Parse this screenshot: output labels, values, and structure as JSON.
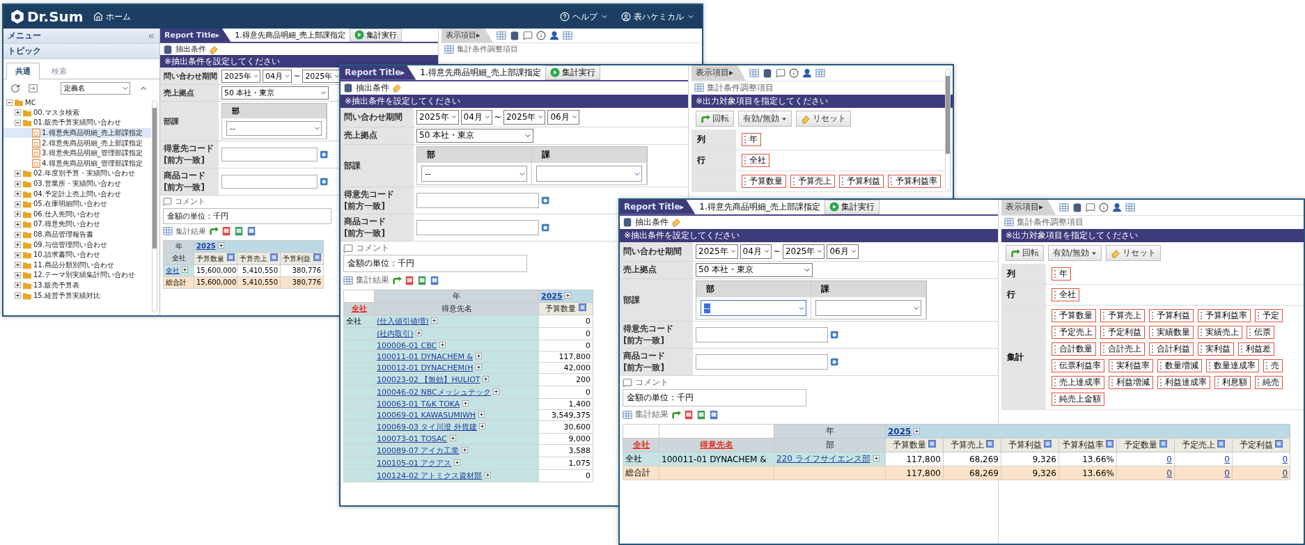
{
  "app": {
    "logo": "Dr.Sum",
    "home": "ホーム",
    "help": "ヘルプ",
    "user": "表ハケミカル"
  },
  "sidebar": {
    "menu": "メニュー",
    "topic": "トピック",
    "tabs": [
      {
        "label": "共通",
        "selected": true
      },
      {
        "label": "検索",
        "selected": false
      }
    ],
    "sort_select": "定義名",
    "tree": [
      {
        "label": "MC",
        "kind": "folder",
        "expanded": true,
        "selected": false,
        "children": [
          {
            "label": "00.マスタ検索",
            "kind": "folder",
            "expanded": false,
            "selected": false
          },
          {
            "label": "01.販売予算実績問い合わせ",
            "kind": "folder",
            "expanded": true,
            "selected": false,
            "children": [
              {
                "label": "1.得意先商品明細_売上部課指定",
                "kind": "report",
                "selected": true
              },
              {
                "label": "2.得意先商品明細_売上部課指定",
                "kind": "report",
                "selected": false
              },
              {
                "label": "3.得意先商品明細_管理部課指定",
                "kind": "report",
                "selected": false
              },
              {
                "label": "4.得意先商品明細_管理部課指定",
                "kind": "report",
                "selected": false
              }
            ]
          },
          {
            "label": "02.年度別予算・実績問い合わせ",
            "kind": "folder",
            "expanded": false,
            "selected": false
          },
          {
            "label": "03.営業所・実績問い合わせ",
            "kind": "folder",
            "expanded": false,
            "selected": false
          },
          {
            "label": "04.予定計上売上問い合わせ",
            "kind": "folder",
            "expanded": false,
            "selected": false
          },
          {
            "label": "05.在庫明細問い合わせ",
            "kind": "folder",
            "expanded": false,
            "selected": false
          },
          {
            "label": "06.仕入先問い合わせ",
            "kind": "folder",
            "expanded": false,
            "selected": false
          },
          {
            "label": "07.得意先問い合わせ",
            "kind": "folder",
            "expanded": false,
            "selected": false
          },
          {
            "label": "08.商品管理報告書",
            "kind": "folder",
            "expanded": false,
            "selected": false
          },
          {
            "label": "09.与信管理問い合わせ",
            "kind": "folder",
            "expanded": false,
            "selected": false
          },
          {
            "label": "10.請求書問い合わせ",
            "kind": "folder",
            "expanded": false,
            "selected": false
          },
          {
            "label": "11.商品分類別問い合わせ",
            "kind": "folder",
            "expanded": false,
            "selected": false
          },
          {
            "label": "12.テーマ別実績集計問い合わせ",
            "kind": "folder",
            "expanded": false,
            "selected": false
          },
          {
            "label": "13.販売予算表",
            "kind": "folder",
            "expanded": false,
            "selected": false
          },
          {
            "label": "15.経営予算実績対比",
            "kind": "folder",
            "expanded": false,
            "selected": false
          }
        ]
      }
    ]
  },
  "reports": [
    {
      "title_tab": "Report Title▸",
      "name": "1.得意先商品明細_売上部課指定",
      "run": "集計実行",
      "extract_label": "抽出条件",
      "banner": "※抽出条件を設定してください",
      "period": {
        "label": "問い合わせ期間",
        "from": [
          "2025年",
          "04月"
        ],
        "separator": "~",
        "to": [
          "2025年"
        ]
      },
      "sales_base": {
        "label": "売上拠点",
        "value": "50 本社・東京"
      },
      "dept": {
        "label": "部課",
        "columns": [
          {
            "header": "部",
            "value": "--",
            "focused": false
          }
        ]
      },
      "codes": [
        {
          "label": "得意先コード",
          "sublabel": "[前方一致]"
        },
        {
          "label": "商品コード",
          "sublabel": "[前方一致]"
        }
      ],
      "comment": {
        "label": "コメント",
        "value": "金額の単位：千円"
      },
      "results_label": "集計結果",
      "table": {
        "year_label": "年",
        "year": "2025",
        "dims": [
          {
            "label": "全社",
            "highlighted": false
          }
        ],
        "measures": [
          {
            "label": "予算数量",
            "linked": false
          },
          {
            "label": "予算売上",
            "linked": false
          },
          {
            "label": "予算利益",
            "linked": false
          }
        ],
        "rows": [
          {
            "kind": "detail",
            "cells": [
              {
                "text": "全社",
                "link": true,
                "expand": true
              }
            ],
            "values": [
              "15,600,000",
              "5,410,550",
              "380,776"
            ]
          },
          {
            "kind": "total",
            "cells": [
              {
                "text": "総合計",
                "link": false,
                "expand": false
              }
            ],
            "values": [
              "15,600,000",
              "5,410,550",
              "380,776"
            ]
          }
        ]
      },
      "display": {
        "tab": "表示項目▸",
        "adjust_label": "集計条件調整項目"
      }
    },
    {
      "title_tab": "Report Title▸",
      "name": "1.得意先商品明細_売上部課指定",
      "run": "集計実行",
      "extract_label": "抽出条件",
      "banner": "※抽出条件を設定してください",
      "period": {
        "label": "問い合わせ期間",
        "from": [
          "2025年",
          "04月"
        ],
        "separator": "~",
        "to": [
          "2025年",
          "06月"
        ]
      },
      "sales_base": {
        "label": "売上拠点",
        "value": "50 本社・東京"
      },
      "dept": {
        "label": "部課",
        "columns": [
          {
            "header": "部",
            "value": "--",
            "focused": false
          },
          {
            "header": "課",
            "focused": false
          }
        ]
      },
      "codes": [
        {
          "label": "得意先コード",
          "sublabel": "[前方一致]"
        },
        {
          "label": "商品コード",
          "sublabel": "[前方一致]"
        }
      ],
      "comment": {
        "label": "コメント",
        "value": "金額の単位：千円"
      },
      "results_label": "集計結果",
      "table": {
        "year_label": "年",
        "year": "2025",
        "dims": [
          {
            "label": "全社",
            "highlighted": true
          },
          {
            "label": "得意先名",
            "highlighted": false
          }
        ],
        "measures": [
          {
            "label": "予算数量",
            "linked": false
          }
        ],
        "rows": [
          {
            "kind": "detail",
            "cells": [
              {
                "text": "全社",
                "link": false,
                "expand": false
              },
              {
                "text": "(仕入値引値増)",
                "link": true,
                "expand": true
              }
            ],
            "values": [
              "0"
            ]
          },
          {
            "kind": "detail",
            "cells": [
              null,
              {
                "text": "(社内取引)",
                "link": true,
                "expand": true
              }
            ],
            "values": [
              "0"
            ]
          },
          {
            "kind": "detail",
            "cells": [
              null,
              {
                "text": "100006-01 CBC",
                "link": true,
                "expand": true
              }
            ],
            "values": [
              "0"
            ]
          },
          {
            "kind": "detail",
            "cells": [
              null,
              {
                "text": "100011-01 DYNACHEM &",
                "link": true,
                "expand": true
              }
            ],
            "values": [
              "117,800"
            ]
          },
          {
            "kind": "detail",
            "cells": [
              null,
              {
                "text": "100012-01 DYNACHEM(H",
                "link": true,
                "expand": true
              }
            ],
            "values": [
              "42,000"
            ]
          },
          {
            "kind": "detail",
            "cells": [
              null,
              {
                "text": "100023-02 【無効】HULIOT",
                "link": true,
                "expand": true
              }
            ],
            "values": [
              "200"
            ]
          },
          {
            "kind": "detail",
            "cells": [
              null,
              {
                "text": "100046-02 NBCメッシュテック",
                "link": true,
                "expand": true
              }
            ],
            "values": [
              "0"
            ]
          },
          {
            "kind": "detail",
            "cells": [
              null,
              {
                "text": "100063-01 T&K TOKA",
                "link": true,
                "expand": true
              }
            ],
            "values": [
              "1,400"
            ]
          },
          {
            "kind": "detail",
            "cells": [
              null,
              {
                "text": "100069-01 KAWASUMIWH",
                "link": true,
                "expand": true
              }
            ],
            "values": [
              "3,549,375"
            ]
          },
          {
            "kind": "detail",
            "cells": [
              null,
              {
                "text": "100069-03 タイ川澄 外貨建",
                "link": true,
                "expand": true
              }
            ],
            "values": [
              "30,600"
            ]
          },
          {
            "kind": "detail",
            "cells": [
              null,
              {
                "text": "100073-01 TOSAC",
                "link": true,
                "expand": true
              }
            ],
            "values": [
              "9,000"
            ]
          },
          {
            "kind": "detail",
            "cells": [
              null,
              {
                "text": "100089-07 アイカ工業",
                "link": true,
                "expand": true
              }
            ],
            "values": [
              "3,588"
            ]
          },
          {
            "kind": "detail",
            "cells": [
              null,
              {
                "text": "100105-01 アクアス",
                "link": true,
                "expand": true
              }
            ],
            "values": [
              "1,075"
            ]
          },
          {
            "kind": "detail",
            "cells": [
              null,
              {
                "text": "100124-02 アトミクス資材部",
                "link": true,
                "expand": true
              }
            ],
            "values": [
              "0"
            ]
          }
        ]
      },
      "display": {
        "tab": "表示項目▸",
        "adjust_label": "集計条件調整項目",
        "banner": "※出力対象項目を指定してください",
        "buttons": [
          {
            "label": "回転",
            "kind": "rotate"
          },
          {
            "label": "有効/無効",
            "kind": "menu"
          },
          {
            "label": "リセット",
            "kind": "reset"
          }
        ],
        "axes": [
          {
            "label": "列",
            "tag_rows": [
              [
                "年"
              ]
            ]
          },
          {
            "label": "行",
            "tag_rows": [
              [
                "全社"
              ]
            ]
          },
          {
            "tag_rows": [
              [
                "予算数量",
                "予算売上",
                "予算利益",
                "予算利益率"
              ]
            ]
          }
        ]
      }
    },
    {
      "title_tab": "Report Title▸",
      "name": "1.得意先商品明細_売上部課指定",
      "run": "集計実行",
      "extract_label": "抽出条件",
      "banner": "※抽出条件を設定してください",
      "period": {
        "label": "問い合わせ期間",
        "from": [
          "2025年",
          "04月"
        ],
        "separator": "~",
        "to": [
          "2025年",
          "06月"
        ]
      },
      "sales_base": {
        "label": "売上拠点",
        "value": "50 本社・東京"
      },
      "dept": {
        "label": "部課",
        "columns": [
          {
            "header": "部",
            "value": "--",
            "focused": true
          },
          {
            "header": "課",
            "focused": false
          }
        ]
      },
      "codes": [
        {
          "label": "得意先コード",
          "sublabel": "[前方一致]"
        },
        {
          "label": "商品コード",
          "sublabel": "[前方一致]"
        }
      ],
      "comment": {
        "label": "コメント",
        "value": "金額の単位：千円"
      },
      "results_label": "集計結果",
      "table": {
        "year_label": "年",
        "year": "2025",
        "dims": [
          {
            "label": "全社",
            "highlighted": true
          },
          {
            "label": "得意先名",
            "highlighted": true
          },
          {
            "label": "部",
            "highlighted": false
          }
        ],
        "measures": [
          {
            "label": "予算数量",
            "linked": false
          },
          {
            "label": "予算売上",
            "linked": false
          },
          {
            "label": "予算利益",
            "linked": false
          },
          {
            "label": "予算利益率",
            "linked": false
          },
          {
            "label": "予定数量",
            "linked": true
          },
          {
            "label": "予定売上",
            "linked": true
          },
          {
            "label": "予定利益",
            "linked": true
          }
        ],
        "rows": [
          {
            "kind": "detail",
            "cells": [
              {
                "text": "全社",
                "link": false,
                "expand": false
              },
              {
                "text": "100011-01 DYNACHEM &",
                "link": false,
                "expand": false
              },
              {
                "text": "220 ライフサイエンス部",
                "link": true,
                "expand": true
              }
            ],
            "values": [
              "117,800",
              "68,269",
              "9,326",
              "13.66%",
              "0",
              "0",
              "0"
            ]
          },
          {
            "kind": "total",
            "cells": [
              {
                "text": "総合計",
                "link": false,
                "expand": false
              }
            ],
            "values": [
              "117,800",
              "68,269",
              "9,326",
              "13.66%",
              "0",
              "0",
              "0"
            ]
          }
        ]
      },
      "display": {
        "tab": "表示項目▸",
        "adjust_label": "集計条件調整項目",
        "banner": "※出力対象項目を指定してください",
        "buttons": [
          {
            "label": "回転",
            "kind": "rotate"
          },
          {
            "label": "有効/無効",
            "kind": "menu"
          },
          {
            "label": "リセット",
            "kind": "reset"
          }
        ],
        "axes": [
          {
            "label": "列",
            "tag_rows": [
              [
                "年"
              ]
            ]
          },
          {
            "label": "行",
            "tag_rows": [
              [
                "全社"
              ]
            ]
          },
          {
            "label": "集計",
            "tag_rows": [
              [
                "予算数量",
                "予算売上",
                "予算利益",
                "予算利益率",
                "予定"
              ],
              [
                "予定売上",
                "予定利益",
                "実績数量",
                "実績売上",
                "伝票"
              ],
              [
                "合計数量",
                "合計売上",
                "合計利益",
                "実利益",
                "利益差"
              ],
              [
                "伝票利益率",
                "実利益率",
                "数量増減",
                "数量達成率",
                "売"
              ],
              [
                "売上達成率",
                "利益増減",
                "利益達成率",
                "利息額",
                "純売"
              ],
              [
                "純売上金額"
              ]
            ]
          }
        ]
      }
    }
  ]
}
